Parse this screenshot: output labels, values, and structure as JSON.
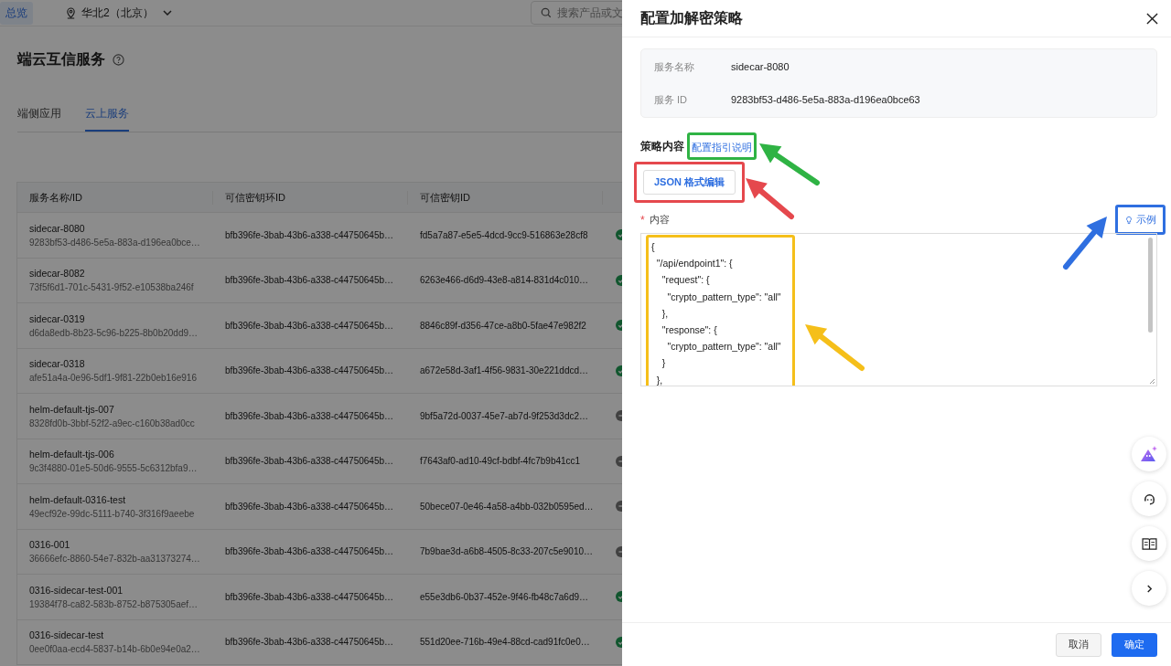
{
  "top_bar": {
    "overview": "总览",
    "region": "华北2（北京）",
    "search_placeholder": "搜索产品或文"
  },
  "page": {
    "title": "端云互信服务",
    "tabs": [
      {
        "label": "端侧应用",
        "selected": false
      },
      {
        "label": "云上服务",
        "selected": true
      }
    ]
  },
  "table": {
    "columns": [
      "服务名称/ID",
      "可信密钥环ID",
      "可信密钥ID"
    ],
    "rows": [
      {
        "name": "sidecar-8080",
        "id": "9283bf53-d486-5e5a-883a-d196ea0bce…",
        "keyring": "bfb396fe-3bab-43b6-a338-c44750645b…",
        "key": "fd5a7a87-e5e5-4dcd-9cc9-516863e28cf8",
        "active": true
      },
      {
        "name": "sidecar-8082",
        "id": "73f5f6d1-701c-5431-9f52-e10538ba246f",
        "keyring": "bfb396fe-3bab-43b6-a338-c44750645b…",
        "key": "6263e466-d6d9-43e8-a814-831d4c010…",
        "active": true
      },
      {
        "name": "sidecar-0319",
        "id": "d6da8edb-8b23-5c96-b225-8b0b20dd9…",
        "keyring": "bfb396fe-3bab-43b6-a338-c44750645b…",
        "key": "8846c89f-d356-47ce-a8b0-5fae47e982f2",
        "active": true
      },
      {
        "name": "sidecar-0318",
        "id": "afe51a4a-0e96-5df1-9f81-22b0eb16e916",
        "keyring": "bfb396fe-3bab-43b6-a338-c44750645b…",
        "key": "a672e58d-3af1-4f56-9831-30e221ddcd…",
        "active": true
      },
      {
        "name": "helm-default-tjs-007",
        "id": "8328fd0b-3bbf-52f2-a9ec-c160b38ad0cc",
        "keyring": "bfb396fe-3bab-43b6-a338-c44750645b…",
        "key": "9bf5a72d-0037-45e7-ab7d-9f253d3dc2…",
        "active": false
      },
      {
        "name": "helm-default-tjs-006",
        "id": "9c3f4880-01e5-50d6-9555-5c6312bfa9…",
        "keyring": "bfb396fe-3bab-43b6-a338-c44750645b…",
        "key": "f7643af0-ad10-49cf-bdbf-4fc7b9b41cc1",
        "active": false
      },
      {
        "name": "helm-default-0316-test",
        "id": "49ecf92e-99dc-5111-b740-3f316f9aeebe",
        "keyring": "bfb396fe-3bab-43b6-a338-c44750645b…",
        "key": "50bece07-0e46-4a58-a4bb-032b0595ed…",
        "active": false
      },
      {
        "name": "0316-001",
        "id": "36666efc-8860-54e7-832b-aa31373274…",
        "keyring": "bfb396fe-3bab-43b6-a338-c44750645b…",
        "key": "7b9bae3d-a6b8-4505-8c33-207c5e9010…",
        "active": false
      },
      {
        "name": "0316-sidecar-test-001",
        "id": "19384f78-ca82-583b-8752-b875305aef…",
        "keyring": "bfb396fe-3bab-43b6-a338-c44750645b…",
        "key": "e55e3db6-0b37-452e-9f46-fb48c7a6d9…",
        "active": true
      },
      {
        "name": "0316-sidecar-test",
        "id": "0ee0f0aa-ecd4-5837-b14b-6b0e94e0a2…",
        "keyring": "bfb396fe-3bab-43b6-a338-c44750645b…",
        "key": "551d20ee-716b-49e4-88cd-cad91fc0e0…",
        "active": true
      }
    ]
  },
  "drawer": {
    "title": "配置加解密策略",
    "info": [
      {
        "label": "服务名称",
        "value": "sidecar-8080"
      },
      {
        "label": "服务 ID",
        "value": "9283bf53-d486-5e5a-883a-d196ea0bce63"
      }
    ],
    "policy_label": "策略内容",
    "guide_link": {
      "text": "配置指引说明",
      "color": "#2fb344"
    },
    "json_button": {
      "text": "JSON 格式编辑",
      "color": "#e5484d"
    },
    "content_label": "内容",
    "required_mark": "*",
    "example_link": {
      "text": "示例",
      "color": "#2f6fe0"
    },
    "content": {
      "color": "#f5bf1a",
      "lines": [
        "{",
        "  \"/api/endpoint1\": {",
        "    \"request\": {",
        "      \"crypto_pattern_type\": \"all\"",
        "    },",
        "    \"response\": {",
        "      \"crypto_pattern_type\": \"all\"",
        "    }",
        "  },"
      ]
    },
    "cancel": "取消",
    "confirm": "确定"
  },
  "arrows": [
    {
      "color": "#2fb344"
    },
    {
      "color": "#e5484d"
    },
    {
      "color": "#2f6fe0"
    },
    {
      "color": "#f5bf1a"
    }
  ]
}
